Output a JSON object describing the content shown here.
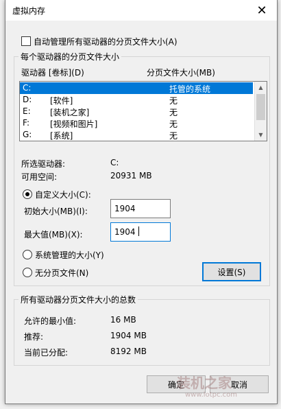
{
  "dialog": {
    "title": "虚拟内存",
    "close": "✕"
  },
  "auto_manage": {
    "label": "自动管理所有驱动器的分页文件大小(A)",
    "checked": false
  },
  "group_drives": {
    "title": "每个驱动器的分页文件大小"
  },
  "list": {
    "col1": "驱动器 [卷标](D)",
    "col2": "分页文件大小(MB)",
    "rows": [
      {
        "drive": "C:",
        "label": "",
        "size": "托管的系统",
        "selected": true
      },
      {
        "drive": "D:",
        "label": "[软件]",
        "size": "无",
        "selected": false
      },
      {
        "drive": "E:",
        "label": "[装机之家]",
        "size": "无",
        "selected": false
      },
      {
        "drive": "F:",
        "label": "[视频和图片]",
        "size": "无",
        "selected": false
      },
      {
        "drive": "G:",
        "label": "[系统]",
        "size": "无",
        "selected": false
      }
    ]
  },
  "selected_drive": {
    "label": "所选驱动器:",
    "value": "C:"
  },
  "available": {
    "label": "可用空间:",
    "value": "20931 MB"
  },
  "custom_size": {
    "label": "自定义大小(C):",
    "selected": true
  },
  "initial_size": {
    "label": "初始大小(MB)(I):",
    "value": "1904"
  },
  "max_size": {
    "label": "最大值(MB)(X):",
    "value": "1904"
  },
  "system_managed": {
    "label": "系统管理的大小(Y)",
    "selected": false
  },
  "no_paging": {
    "label": "无分页文件(N)",
    "selected": false
  },
  "set_button": "设置(S)",
  "group_totals": {
    "title": "所有驱动器分页文件大小的总数"
  },
  "totals": {
    "min_label": "允许的最小值:",
    "min_value": "16 MB",
    "rec_label": "推荐:",
    "rec_value": "1904 MB",
    "cur_label": "当前已分配:",
    "cur_value": "8192 MB"
  },
  "ok_button": "确定",
  "cancel_button": "取消",
  "watermark": {
    "brand": "装机之家",
    "url": "www.lotpc.com"
  }
}
